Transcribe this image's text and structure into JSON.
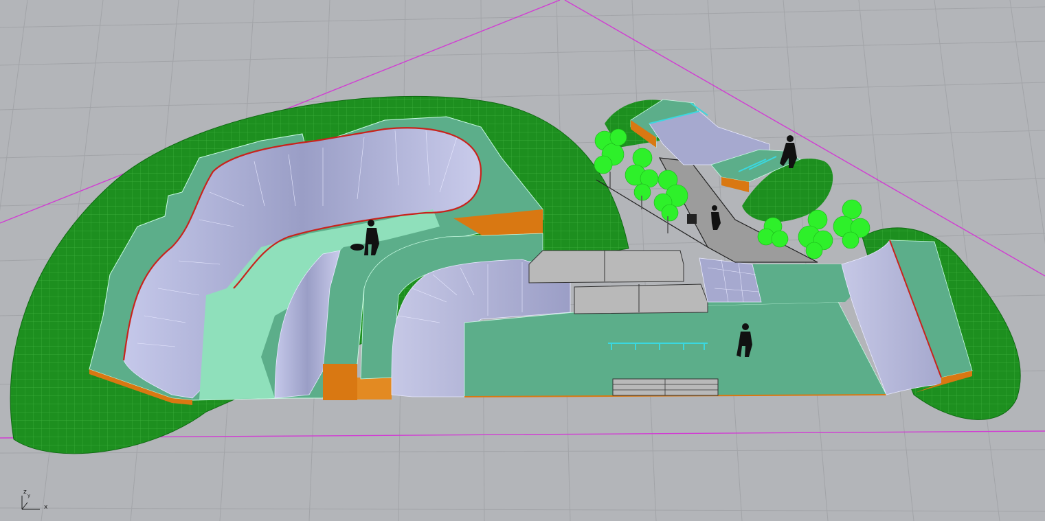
{
  "viewport": {
    "axes": {
      "x_label": "x",
      "y_label": "y",
      "z_label": "z"
    }
  },
  "colors": {
    "background": "#b3b5b9",
    "grid": "#a2a4a8",
    "boundary": "#d13cd3",
    "terrain": "#1d8f1f",
    "deck": "#5cae8a",
    "bowl_surface": "#a6a9cf",
    "coping": "#c8231c",
    "wall": "#d97812",
    "concrete": "#b9b9b9",
    "rail": "#3ad8e0",
    "tree": "#2ef02a",
    "figure": "#111111"
  },
  "icons": {
    "axis_gizmo": "axis-gizmo-icon",
    "skater": "skater-silhouette",
    "tree": "tree-icon"
  }
}
